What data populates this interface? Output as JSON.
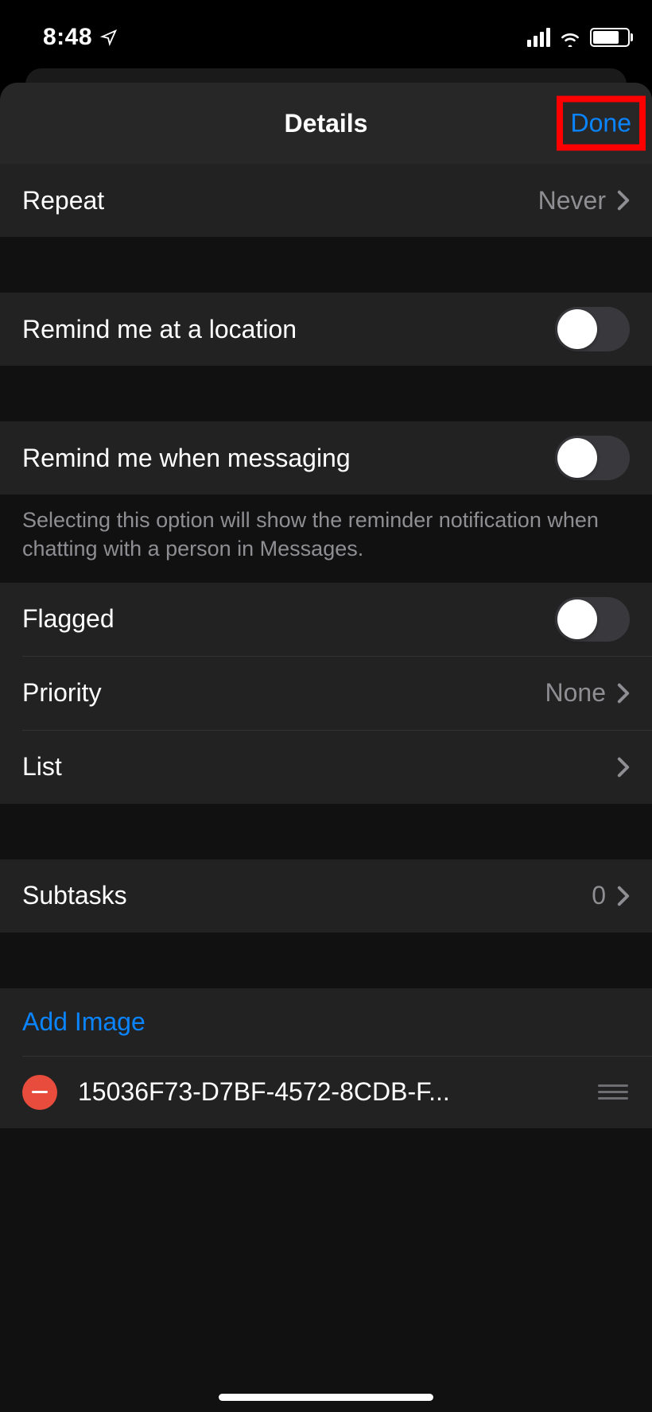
{
  "status": {
    "time": "8:48"
  },
  "nav": {
    "title": "Details",
    "done": "Done"
  },
  "rows": {
    "repeat": {
      "label": "Repeat",
      "value": "Never"
    },
    "location": {
      "label": "Remind me at a location"
    },
    "messaging": {
      "label": "Remind me when messaging",
      "footer": "Selecting this option will show the reminder notification when chatting with a person in Messages."
    },
    "flagged": {
      "label": "Flagged"
    },
    "priority": {
      "label": "Priority",
      "value": "None"
    },
    "list": {
      "label": "List"
    },
    "subtasks": {
      "label": "Subtasks",
      "value": "0"
    },
    "addImage": {
      "label": "Add Image"
    },
    "attachment": {
      "name": "15036F73-D7BF-4572-8CDB-F..."
    }
  }
}
